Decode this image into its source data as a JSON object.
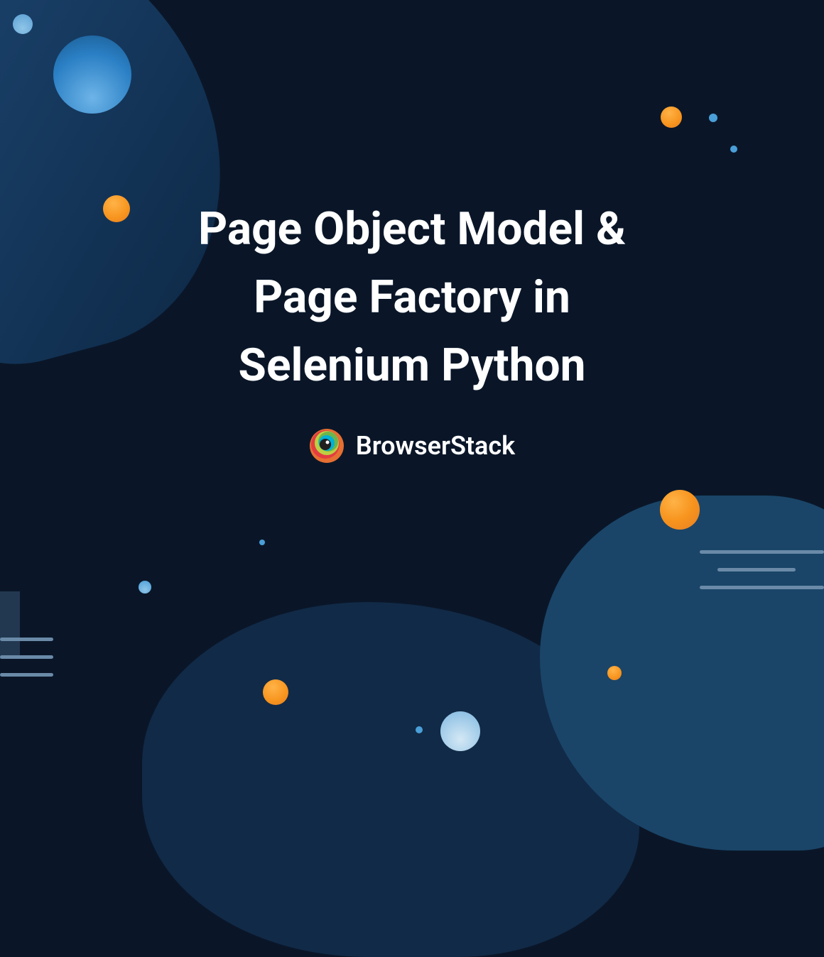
{
  "title_line1": "Page Object Model &",
  "title_line2": "Page Factory in",
  "title_line3": "Selenium Python",
  "brand_name": "BrowserStack"
}
